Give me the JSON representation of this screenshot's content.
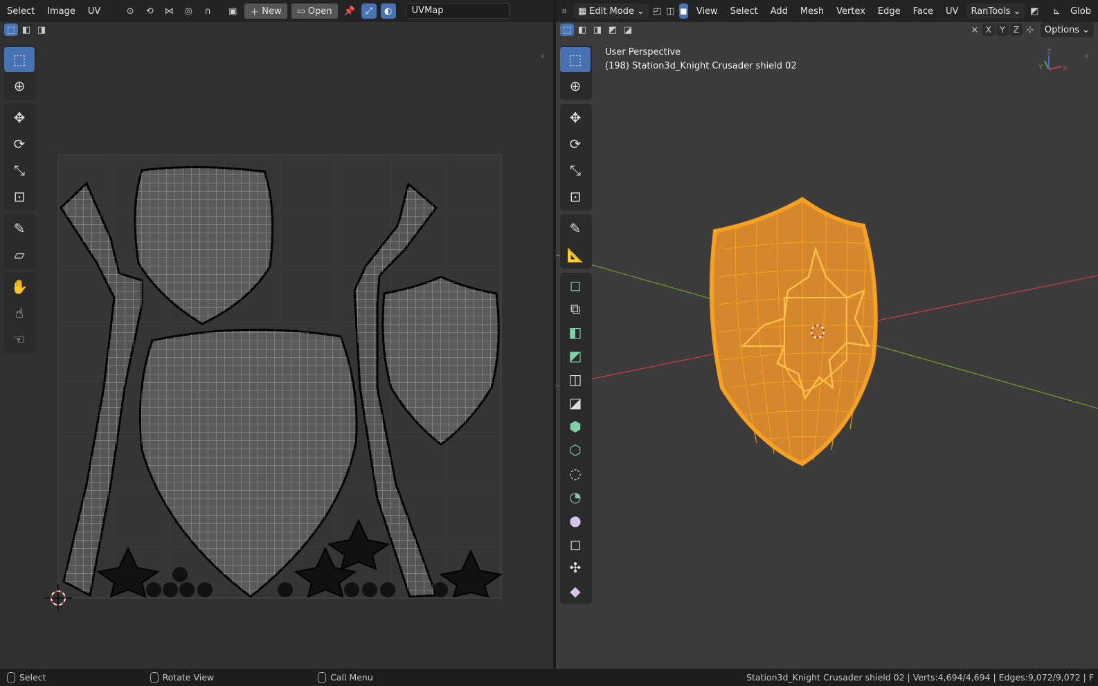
{
  "uv_editor": {
    "menu": [
      "Select",
      "Image",
      "UV"
    ],
    "new_label": "New",
    "open_label": "Open",
    "uvmap_name": "UVMap"
  },
  "viewport": {
    "mode": "Edit Mode",
    "menu": [
      "View",
      "Select",
      "Add",
      "Mesh",
      "Vertex",
      "Edge",
      "Face",
      "UV",
      "RanTools"
    ],
    "orientation": "Glob",
    "axes": [
      "X",
      "Y",
      "Z"
    ],
    "options_label": "Options",
    "view_name": "User Perspective",
    "object_label": "(198) Station3d_Knight Crusader shield 02",
    "gizmo_axes": [
      "X",
      "Y",
      "Z"
    ]
  },
  "status": {
    "select": "Select",
    "rotate": "Rotate View",
    "call_menu": "Call Menu",
    "stats": "Station3d_Knight Crusader shield 02 | Verts:4,694/4,694 | Edges:9,072/9,072 | F"
  },
  "colors": {
    "accent": "#4772b3",
    "selection": "#f5a020",
    "x_axis": "#c63a4a",
    "y_axis": "#6e9a2a"
  }
}
